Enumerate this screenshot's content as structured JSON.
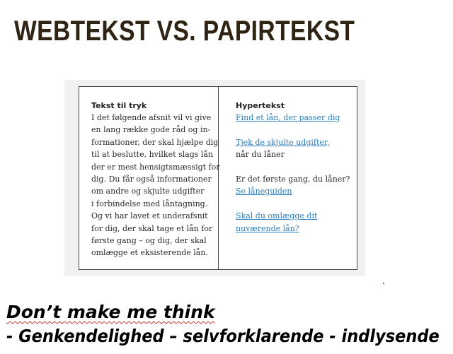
{
  "slide": {
    "title": "WEBTEKST VS. PAPIRTEKST"
  },
  "figure": {
    "print_page": {
      "heading": "Tekst til tryk",
      "lines": [
        "I det følgende afsnit vil vi give",
        "en lang række gode råd og in-",
        "formationer, der skal hjælpe dig",
        "til at beslutte, hvilket slags lån",
        "der er mest hensigtsmæssigt for",
        "dig. Du får også informationer",
        "om andre og skjulte udgifter",
        "i forbindelse med låntagning.",
        "Og vi har lavet et underafsnit",
        "for dig, der skal tage et lån for",
        "første gang – og dig, der skal",
        "omlægge et eksisterende lån."
      ]
    },
    "hypertext_page": {
      "heading": "Hypertekst",
      "link_find_loan": "Find et lån, der passer dig",
      "link_hidden_costs": "Tjek de skjulte udgifter,",
      "text_when_borrowing": "når du låner",
      "text_first_time": "Er det første gang, du låner?",
      "link_loan_guide": "Se låneguiden",
      "link_refinance_line1": "Skal du omlægge dit",
      "link_refinance_line2": "nuværende lån?"
    }
  },
  "tagline": {
    "line1": "Don’t make me think",
    "line2": "- Genkendelighed – selvforklarende - indlysende"
  },
  "colors": {
    "title": "#2f2413",
    "link": "#2b7fc0",
    "spellcheck_underline": "#d32f2f"
  }
}
